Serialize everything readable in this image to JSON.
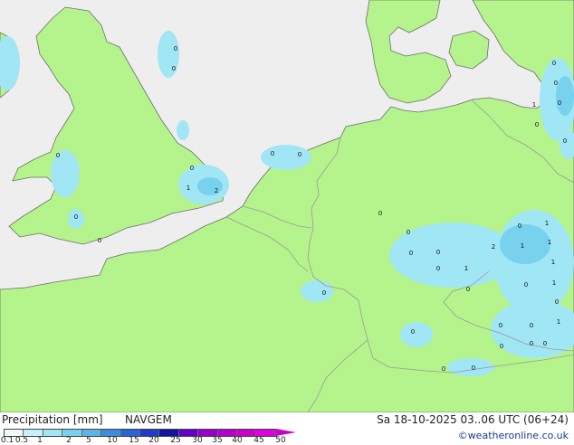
{
  "map": {
    "colors": {
      "sea": "#eeeeee",
      "land": "#b5f48c",
      "border": "#9a9a9a",
      "coast": "#6e6e6e",
      "precip_light": "#a0e6f5",
      "precip_medium": "#78d2ee"
    },
    "point_values": [
      {
        "v": "0"
      },
      {
        "v": "0"
      },
      {
        "v": "0"
      },
      {
        "v": "0"
      },
      {
        "v": "0"
      },
      {
        "v": "1"
      },
      {
        "v": "2"
      },
      {
        "v": "0"
      },
      {
        "v": "0"
      },
      {
        "v": "0"
      },
      {
        "v": "0"
      },
      {
        "v": "0"
      },
      {
        "v": "0"
      },
      {
        "v": "0"
      },
      {
        "v": "0"
      },
      {
        "v": "0"
      },
      {
        "v": "1"
      },
      {
        "v": "2"
      },
      {
        "v": "1"
      },
      {
        "v": "1"
      },
      {
        "v": "0"
      },
      {
        "v": "1"
      },
      {
        "v": "1"
      },
      {
        "v": "0"
      },
      {
        "v": "0"
      },
      {
        "v": "1"
      },
      {
        "v": "0"
      },
      {
        "v": "0"
      },
      {
        "v": "0"
      },
      {
        "v": "0"
      },
      {
        "v": "1"
      },
      {
        "v": "0"
      },
      {
        "v": "0"
      },
      {
        "v": "0"
      },
      {
        "v": "0"
      },
      {
        "v": "0"
      },
      {
        "v": "0"
      },
      {
        "v": "0"
      },
      {
        "v": "1"
      },
      {
        "v": "0"
      },
      {
        "v": "0"
      },
      {
        "v": "0"
      }
    ]
  },
  "footer": {
    "legend_title": "Precipitation [mm]",
    "model": "NAVGEM",
    "run_time": "Sa 18-10-2025 03..06 UTC (06+24)",
    "credit": "©weatheronline.co.uk",
    "scale_labels": [
      "0.1",
      "0.5",
      "1",
      "2",
      "5",
      "10",
      "15",
      "20",
      "25",
      "30",
      "35",
      "40",
      "45",
      "50"
    ],
    "scale_colors": [
      "#f0fbfe",
      "#c8f0fa",
      "#a0e6f5",
      "#78d2ee",
      "#5ab4e6",
      "#3c8cdc",
      "#2864d2",
      "#1e3cc8",
      "#1414a0",
      "#6400c8",
      "#9600c8",
      "#b400c8",
      "#c800c8",
      "#dc00dc"
    ]
  }
}
